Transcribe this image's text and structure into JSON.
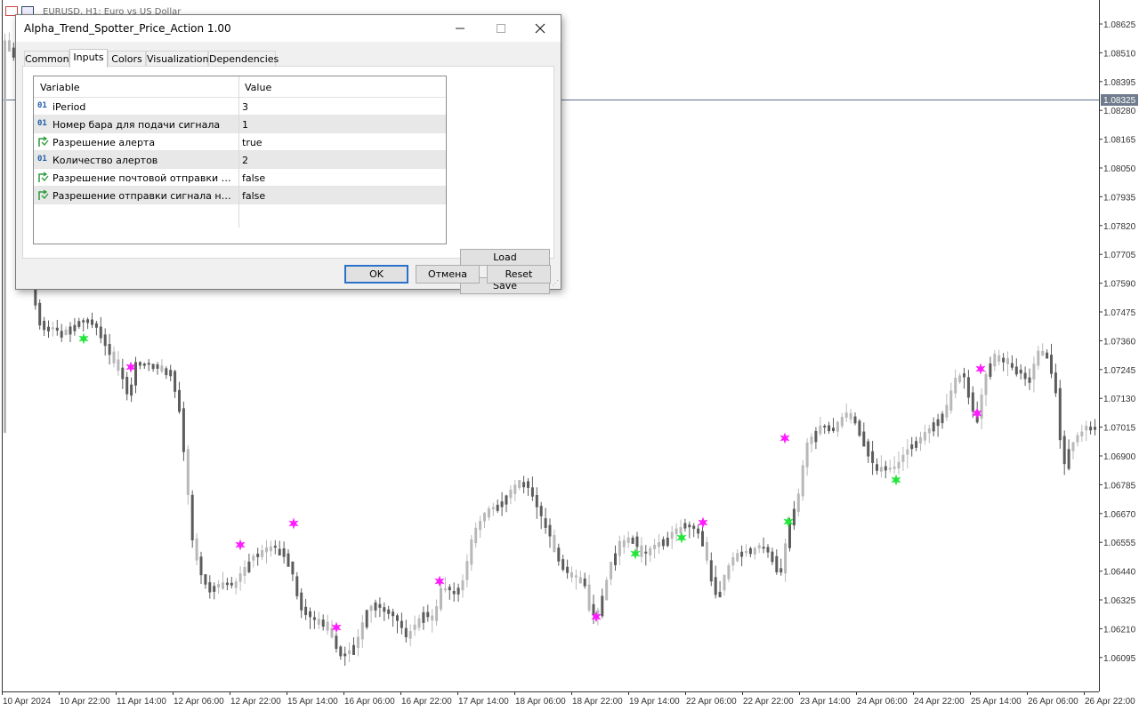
{
  "chart": {
    "title": "EURUSD, H1:  Euro vs US Dollar",
    "current_price": "1.08325",
    "price_labels": [
      "1.08625",
      "1.08510",
      "1.08395",
      "1.08280",
      "1.08165",
      "1.08050",
      "1.07935",
      "1.07820",
      "1.07705",
      "1.07590",
      "1.07475",
      "1.07360",
      "1.07245",
      "1.07130",
      "1.07015",
      "1.06900",
      "1.06785",
      "1.06670",
      "1.06555",
      "1.06440",
      "1.06325",
      "1.06210",
      "1.06095"
    ],
    "time_labels": [
      "10 Apr 2024",
      "10 Apr 22:00",
      "11 Apr 14:00",
      "12 Apr 06:00",
      "12 Apr 22:00",
      "15 Apr 14:00",
      "16 Apr 06:00",
      "16 Apr 22:00",
      "17 Apr 14:00",
      "18 Apr 06:00",
      "18 Apr 22:00",
      "19 Apr 14:00",
      "22 Apr 06:00",
      "22 Apr 22:00",
      "23 Apr 14:00",
      "24 Apr 06:00",
      "24 Apr 22:00",
      "25 Apr 14:00",
      "26 Apr 06:00",
      "26 Apr 22:00"
    ],
    "colors": {
      "bull": "#b8b8b8",
      "bear": "#5c5c5c",
      "buy_signal": "#22e63a",
      "sell_signal": "#ff1aff",
      "price_line": "#5a6e8c"
    }
  },
  "dialog": {
    "title": "Alpha_Trend_Spotter_Price_Action 1.00",
    "tabs": [
      {
        "label": "Common"
      },
      {
        "label": "Inputs"
      },
      {
        "label": "Colors"
      },
      {
        "label": "Visualization"
      },
      {
        "label": "Dependencies"
      }
    ],
    "grid": {
      "col_variable": "Variable",
      "col_value": "Value",
      "rows": [
        {
          "icon": "01",
          "name": "iPeriod",
          "value": "3"
        },
        {
          "icon": "01",
          "name": "Номер бара для подачи сигнала",
          "value": "1"
        },
        {
          "icon": "bool",
          "name": "Разрешение алерта",
          "value": "true"
        },
        {
          "icon": "01",
          "name": "Количество алертов",
          "value": "2"
        },
        {
          "icon": "bool",
          "name": "Разрешение почтовой отправки сигн…",
          "value": "false"
        },
        {
          "icon": "bool",
          "name": "Разрешение отправки сигнала на моб…",
          "value": "false"
        }
      ]
    },
    "buttons": {
      "load": "Load",
      "save": "Save",
      "ok": "OK",
      "cancel": "Отмена",
      "reset": "Reset"
    }
  }
}
